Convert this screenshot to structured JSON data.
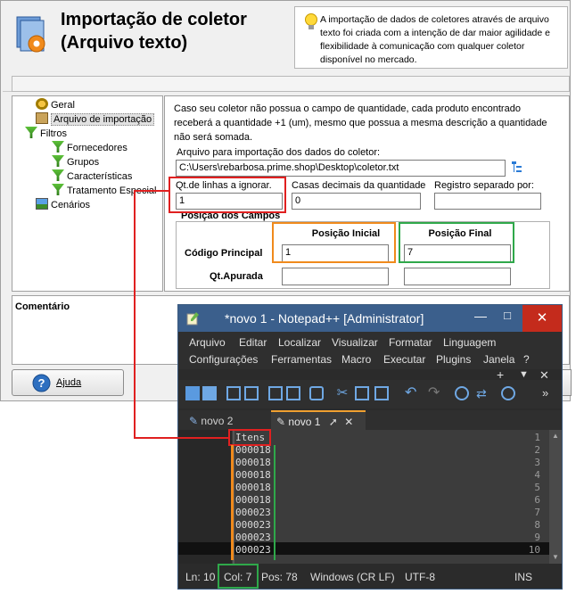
{
  "dialog": {
    "title_line1": "Importação de coletor",
    "title_line2": "(Arquivo texto)",
    "info_text": "A importação de dados de coletores através de arquivo texto foi criada com a intenção de dar maior agilidade e flexibilidade à comunicação com qualquer coletor disponível no mercado.",
    "tree": {
      "items": [
        {
          "label": "Geral"
        },
        {
          "label": "Arquivo de importação"
        },
        {
          "label": "Filtros"
        },
        {
          "label": "Fornecedores"
        },
        {
          "label": "Grupos"
        },
        {
          "label": "Características"
        },
        {
          "label": "Tratamento Especial"
        },
        {
          "label": "Cenários"
        }
      ]
    },
    "panel": {
      "description": "Caso seu coletor não possua o campo de quantidade, cada produto encontrado receberá a quantidade +1 (um), mesmo que possua a mesma descrição a quantidade não será somada.",
      "file_label": "Arquivo para importação dos dados do coletor:",
      "file_value": "C:\\Users\\rebarbosa.prime.shop\\Desktop\\coletor.txt",
      "skip_lines_label": "Qt.de linhas a ignorar.",
      "skip_lines_value": "1",
      "decimals_label": "Casas decimais da quantidade",
      "decimals_value": "0",
      "separator_label": "Registro separado por:",
      "separator_value": "",
      "positions_title": "Posição dos Campos",
      "col_initial": "Posição Inicial",
      "col_final": "Posição Final",
      "row1_label": "Código Principal",
      "row1_initial": "1",
      "row1_final": "7",
      "row2_label": "Qt.Apurada",
      "row2_initial": "",
      "row2_final": ""
    },
    "comment_label": "Comentário",
    "help_button": "Ajuda"
  },
  "notepad": {
    "title": "*novo 1 - Notepad++ [Administrator]",
    "menu_row1": [
      "Arquivo",
      "Editar",
      "Localizar",
      "Visualizar",
      "Formatar",
      "Linguagem"
    ],
    "menu_row2": [
      "Configurações",
      "Ferramentas",
      "Macro",
      "Executar",
      "Plugins",
      "Janela",
      "?"
    ],
    "tabs": [
      {
        "label": "novo 2"
      },
      {
        "label": "novo 1"
      }
    ],
    "lines": [
      {
        "num": "1",
        "text": "Itens"
      },
      {
        "num": "2",
        "text": "000018"
      },
      {
        "num": "3",
        "text": "000018"
      },
      {
        "num": "4",
        "text": "000018"
      },
      {
        "num": "5",
        "text": "000018"
      },
      {
        "num": "6",
        "text": "000018"
      },
      {
        "num": "7",
        "text": "000023"
      },
      {
        "num": "8",
        "text": "000023"
      },
      {
        "num": "9",
        "text": "000023"
      },
      {
        "num": "10",
        "text": "000023"
      }
    ],
    "status": {
      "ln": "Ln: 10",
      "col": "Col: 7",
      "pos": "Pos: 78",
      "eol": "Windows (CR LF)",
      "encoding": "UTF-8",
      "mode": "INS"
    }
  },
  "annotation_colors": {
    "red": "#e02020",
    "orange": "#f08a1c",
    "green": "#2fa84a"
  }
}
